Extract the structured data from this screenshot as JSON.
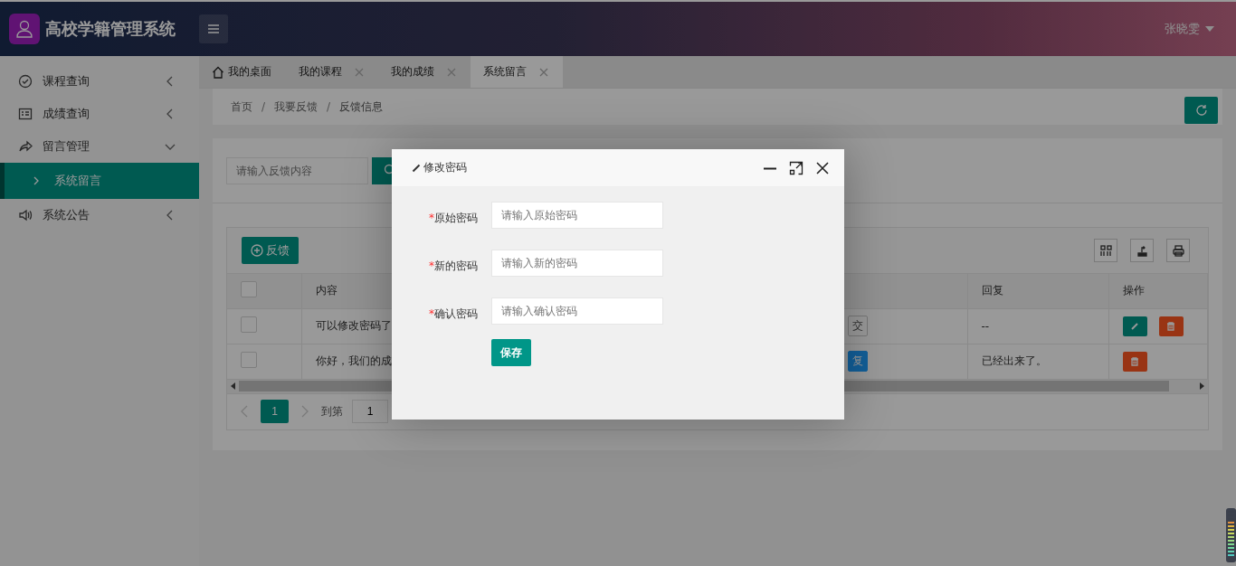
{
  "header": {
    "title": "高校学籍管理系统",
    "user": "张晓雯"
  },
  "sidebar": {
    "items": [
      {
        "label": "课程查询",
        "expanded": false
      },
      {
        "label": "成绩查询",
        "expanded": false
      },
      {
        "label": "留言管理",
        "expanded": true,
        "children": [
          {
            "label": "系统留言",
            "selected": true
          }
        ]
      },
      {
        "label": "系统公告",
        "expanded": false
      }
    ]
  },
  "tabs": [
    {
      "label": "我的桌面",
      "selected": false,
      "closable": false
    },
    {
      "label": "我的课程",
      "selected": false,
      "closable": true
    },
    {
      "label": "我的成绩",
      "selected": false,
      "closable": true
    },
    {
      "label": "系统留言",
      "selected": true,
      "closable": true
    }
  ],
  "breadcrumb": {
    "items": [
      "首页",
      "我要反馈",
      "反馈信息"
    ],
    "separator": "/"
  },
  "search": {
    "placeholder": "请输入反馈内容"
  },
  "table": {
    "add_button": "反馈",
    "header_checked": false,
    "columns": [
      "内容",
      "回复",
      "操作"
    ],
    "rows": [
      {
        "checked": false,
        "content": "可以修改密码了",
        "status": {
          "label": "交",
          "kind": "outline"
        },
        "reply": "--",
        "actions": [
          {
            "kind": "edit"
          },
          {
            "kind": "delete"
          }
        ]
      },
      {
        "checked": false,
        "content": "你好，我们的成",
        "status": {
          "label": "复",
          "kind": "filled"
        },
        "reply": "已经出来了。",
        "actions": [
          {
            "kind": "delete"
          }
        ]
      }
    ]
  },
  "required_mark": "*",
  "pagination": {
    "pages": [
      {
        "label": "1",
        "selected": true
      }
    ],
    "goto_label": "到第",
    "goto_value": "1"
  },
  "modal": {
    "title": "修改密码",
    "fields": [
      {
        "label": "原始密码",
        "required": true,
        "placeholder": "请输入原始密码"
      },
      {
        "label": "新的密码",
        "required": true,
        "placeholder": "请输入新的密码"
      },
      {
        "label": "确认密码",
        "required": true,
        "placeholder": "请输入确认密码"
      }
    ],
    "button": "保存"
  }
}
